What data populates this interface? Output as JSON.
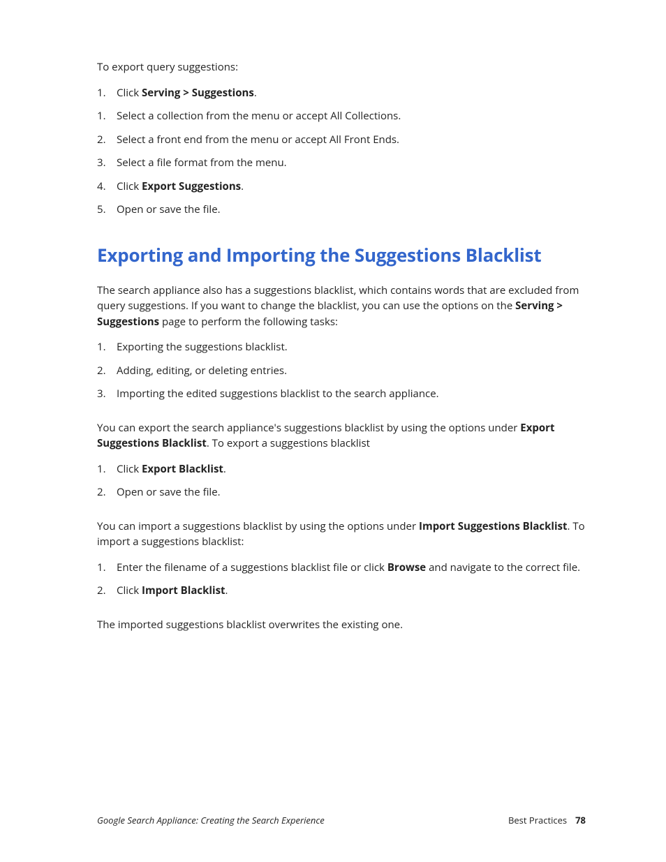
{
  "section1": {
    "intro": "To export query suggestions:",
    "steps": [
      {
        "num": "1.",
        "pre": "Click ",
        "bold": "Serving > Suggestions",
        "post": "."
      },
      {
        "num": "1.",
        "pre": "Select a collection from the menu or accept All Collections.",
        "bold": "",
        "post": ""
      },
      {
        "num": "2.",
        "pre": "Select a front end from the menu or accept All Front Ends.",
        "bold": "",
        "post": ""
      },
      {
        "num": "3.",
        "pre": "Select a file format from the menu.",
        "bold": "",
        "post": ""
      },
      {
        "num": "4.",
        "pre": "Click ",
        "bold": "Export Suggestions",
        "post": "."
      },
      {
        "num": "5.",
        "pre": "Open or save the file.",
        "bold": "",
        "post": ""
      }
    ]
  },
  "section2": {
    "heading": "Exporting and Importing the Suggestions Blacklist",
    "para1_pre": "The search appliance also has a suggestions blacklist, which contains words that are excluded from query suggestions. If you want to change the blacklist, you can use the options on the ",
    "para1_bold": "Serving > Suggestions",
    "para1_post": " page to perform the following tasks:",
    "tasks": [
      {
        "num": "1.",
        "text": "Exporting the suggestions blacklist."
      },
      {
        "num": "2.",
        "text": "Adding, editing, or deleting entries."
      },
      {
        "num": "3.",
        "text": "Importing the edited suggestions blacklist to the search appliance."
      }
    ],
    "para2_pre": "You can export the search appliance's suggestions blacklist by using the options under ",
    "para2_bold": "Export Suggestions Blacklist",
    "para2_post": ". To export a suggestions blacklist",
    "exportSteps": [
      {
        "num": "1.",
        "pre": "Click ",
        "bold": "Export Blacklist",
        "post": "."
      },
      {
        "num": "2.",
        "pre": "Open or save the file.",
        "bold": "",
        "post": ""
      }
    ],
    "para3_pre": "You can import a suggestions blacklist by using the options under ",
    "para3_bold": "Import Suggestions Blacklist",
    "para3_post": ". To import a suggestions blacklist:",
    "importSteps": [
      {
        "num": "1.",
        "pre": "Enter the filename of a suggestions blacklist file or click ",
        "bold": "Browse",
        "post": " and navigate to the correct file."
      },
      {
        "num": "2.",
        "pre": "Click ",
        "bold": "Import Blacklist",
        "post": "."
      }
    ],
    "closing": "The imported suggestions blacklist overwrites the existing one."
  },
  "footer": {
    "left": "Google Search Appliance: Creating the Search Experience",
    "rightLabel": "Best Practices",
    "pageNum": "78"
  }
}
